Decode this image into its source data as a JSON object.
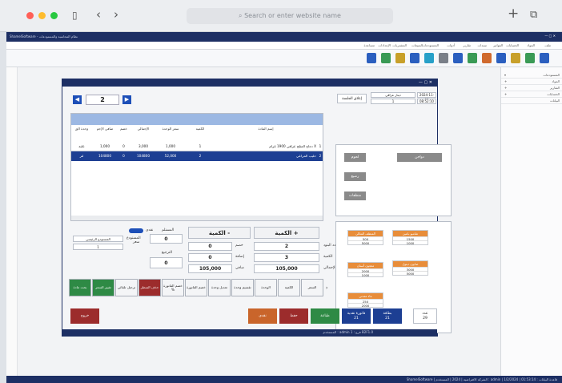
{
  "browser": {
    "url_placeholder": "Search or enter website name"
  },
  "app": {
    "title": "ShamelSoftware - نظام المحاسبة والمستودعات",
    "menu": [
      "ملف",
      "المواد",
      "الحسابات",
      "الفواتير",
      "سندات",
      "تقارير",
      "أدوات",
      "المستودعات",
      "المبيعات",
      "المشتريات",
      "الإعدادات",
      "مساعدة"
    ],
    "right_panel": [
      {
        "icon": "▾",
        "label": "المستودعات"
      },
      {
        "icon": "+",
        "label": "المواد"
      },
      {
        "icon": "+",
        "label": "التقارير"
      },
      {
        "icon": "+",
        "label": "الحسابات"
      },
      {
        "icon": "",
        "label": "البيانات"
      }
    ],
    "statusbar": "ShamelSoftware | الشركة الافتراضية | 2024 | المستخدم : admin | قاعدة البيانات : 01:53:14 | 1/2/2024"
  },
  "modal": {
    "page_number": "2",
    "date": "2024-11-09",
    "time": "08:52:10",
    "customer": "نقدي",
    "currency": "دينار عراقي",
    "rate": "1",
    "close_label": "إغلاق الجلسة",
    "columns": [
      "وحدة الق",
      "صافي الإجم",
      "خصم",
      "الإجمالي",
      "سعر الوحدة",
      "الكمية",
      "إسم المادة",
      ""
    ],
    "rows": [
      [
        "علبة",
        "1,000",
        "0",
        "3,000",
        "1,000",
        "1",
        "دجاج المثلج عراقي 1900 غرام X",
        "1"
      ],
      [
        "لتر",
        "104800",
        "0",
        "104800",
        "52,000",
        "2",
        "حليب المراعي",
        "2"
      ]
    ],
    "qty_plus": "الكمية +",
    "qty_minus": "الكمية -",
    "labels": {
      "items_count": "عدد البنود",
      "quantity": "الكمية",
      "total": "الإجمالي",
      "discount": "خصم",
      "extra": "إضافة",
      "net": "صافي",
      "received": "المستلم",
      "rest": "الباقي",
      "remaining_label": "الترجيع",
      "main_store": "المستودع الرئيسي",
      "store": "المستودع",
      "price": "سعر",
      "toggle": "نقدي"
    },
    "values": {
      "items_count": "2",
      "quantity": "3",
      "total": "105,000",
      "discount": "0",
      "extra": "0",
      "net": "105,000",
      "received": "0",
      "return": "0",
      "store_code": "1",
      "price_val": "0"
    },
    "actions": [
      "السعر",
      "الكمية",
      "الوحدة",
      "تقسيم وحدة",
      "تعديل وحدة",
      "خصم الفاتورة",
      "خصم الفاتورة %",
      "حذف السطر",
      "ترحيل تلقائي",
      "تغيير السعر",
      "بحث مادة"
    ],
    "categories": [
      "منظفات",
      "رضيع",
      "لحوم",
      "دواجن"
    ],
    "products": [
      {
        "name": "المنظف المثالي",
        "price": "500",
        "stock": "5000"
      },
      {
        "name": "شامبو بانتين",
        "price": "1500",
        "stock": "1000"
      },
      {
        "name": "معجون أسنان",
        "price": "2000",
        "stock": "1000"
      },
      {
        "name": "صابون ديتول",
        "price": "3000",
        "stock": "5000"
      },
      {
        "name": "ماء معدني",
        "price": "250",
        "stock": "2000"
      }
    ],
    "bottom": {
      "exit": "خروج",
      "pay_cash": "نقدي",
      "save": "حفظ",
      "print": "طباعة",
      "deferred": "آجل",
      "deferred_value": "21",
      "cash_bill": "فاتورة نقدية",
      "cash_value": "21",
      "credit": "بطاقة",
      "credit_value": "21",
      "count": "عدد",
      "count_value": "29"
    },
    "status": "المستخدم : admin   فرع : 1   B2F1.0"
  }
}
